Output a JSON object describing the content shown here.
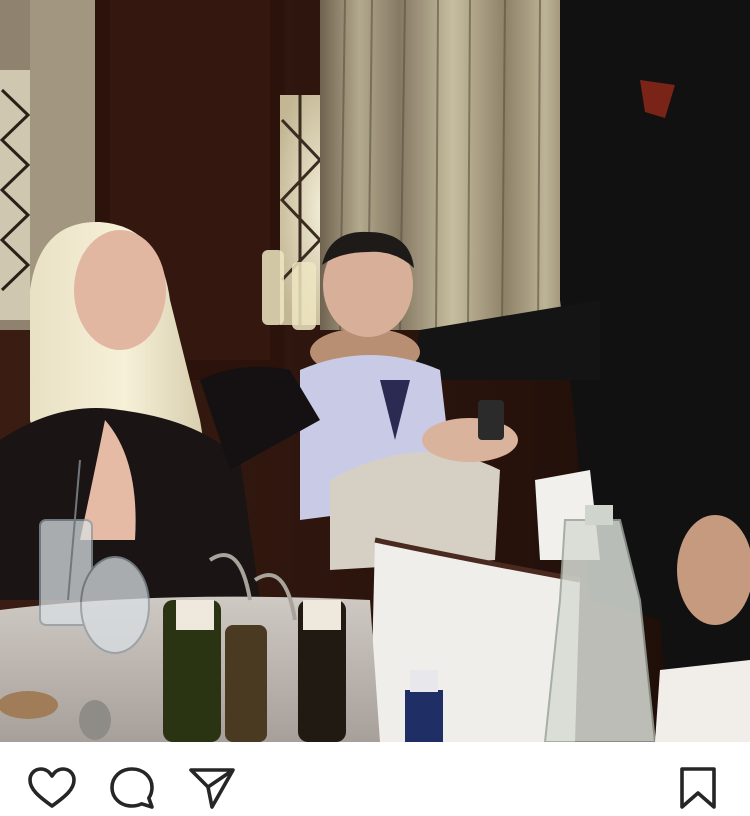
{
  "post": {
    "media_type": "photo",
    "accessibility": ""
  },
  "actions": [
    {
      "key": "like",
      "icon": "heart-icon"
    },
    {
      "key": "comment",
      "icon": "comment-bubble-icon"
    },
    {
      "key": "share",
      "icon": "paper-plane-icon"
    },
    {
      "key": "save",
      "icon": "bookmark-icon"
    }
  ],
  "colors": {
    "icon": "#262626",
    "background": "#ffffff"
  }
}
